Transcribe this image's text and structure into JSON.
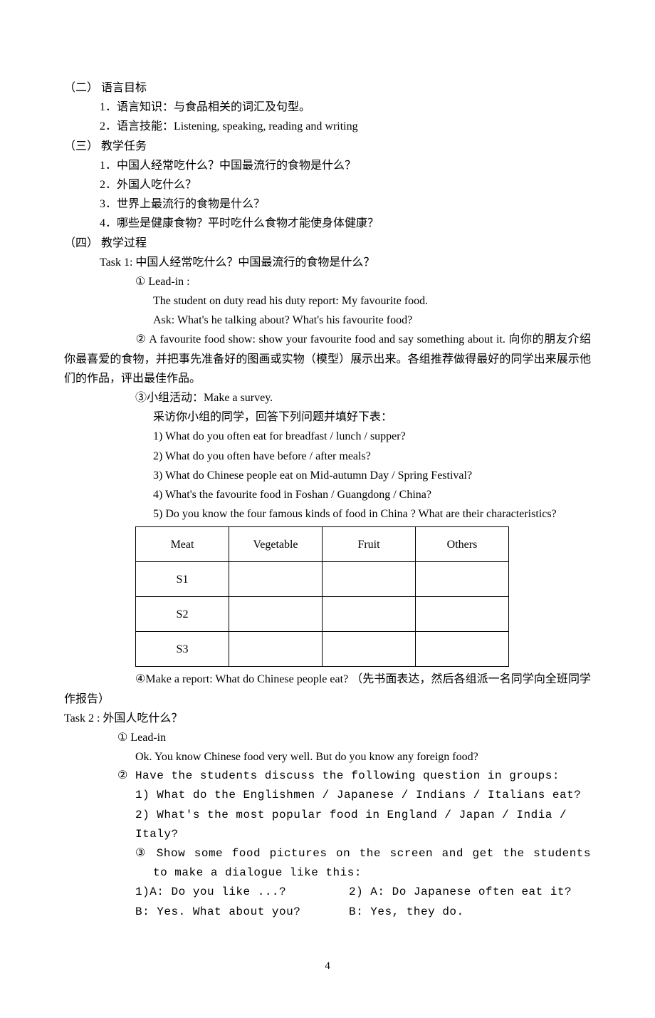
{
  "sec2": {
    "title": "（二） 语言目标",
    "item1": "1．语言知识：与食品相关的词汇及句型。",
    "item2": "2．语言技能：Listening, speaking, reading and writing"
  },
  "sec3": {
    "title": "（三） 教学任务",
    "item1": "1．中国人经常吃什么？中国最流行的食物是什么？",
    "item2": "2．外国人吃什么？",
    "item3": "3．世界上最流行的食物是什么？",
    "item4": "4．哪些是健康食物？平时吃什么食物才能使身体健康？"
  },
  "sec4": {
    "title": "（四） 教学过程",
    "task1": {
      "title": "Task 1:  中国人经常吃什么？中国最流行的食物是什么？",
      "p1": "①  Lead-in :",
      "p1a": "The student on duty read his duty report: My favourite food.",
      "p1b": "Ask: What's he talking about? What's his favourite food?",
      "p2": "②  A favourite food show: show your favourite food and say something about it.  向你的朋友介绍你最喜爱的食物，并把事先准备好的图画或实物（模型）展示出来。各组推荐做得最好的同学出来展示他们的作品，评出最佳作品。",
      "p3": "③小组活动：Make a survey.",
      "p3a": "采访你小组的同学，回答下列问题并填好下表：",
      "q1": "1)   What do you often eat for breadfast / lunch / supper?",
      "q2": "2)   What do you often have before / after meals?",
      "q3": "3)   What do Chinese people eat on Mid-autumn Day / Spring Festival?",
      "q4": "4)   What's the favourite food in Foshan / Guangdong / China?",
      "q5": "5)    Do  you  know  the  four  famous  kinds  of  food  in  China  ?  What  are  their characteristics?",
      "table": {
        "h1": "Meat",
        "h2": "Vegetable",
        "h3": "Fruit",
        "h4": "Others",
        "r1": "S1",
        "r2": "S2",
        "r3": "S3"
      },
      "p4": "④Make a report: What do Chinese people eat?  （先书面表达，然后各组派一名同学向全班同学作报告）"
    },
    "task2": {
      "title": "Task 2 :  外国人吃什么？",
      "p1": "①  Lead-in",
      "p1a": "Ok. You know Chinese food very well. But do you know any foreign food?",
      "p2": "② Have the students discuss the following question in groups:",
      "p2a": "1) What do the Englishmen / Japanese / Indians / Italians eat?",
      "p2b": " 2) What's the most popular food in England / Japan / India / Italy?",
      "p3": "③ Show some food pictures on the screen and get the students to make a dialogue like this:",
      "d1a": "1)A: Do you like ...?",
      "d1b": "2) A: Do Japanese often eat it?",
      "d2a": "  B: Yes. What about you?",
      "d2b": "   B: Yes, they do."
    }
  },
  "pagenum": "4"
}
